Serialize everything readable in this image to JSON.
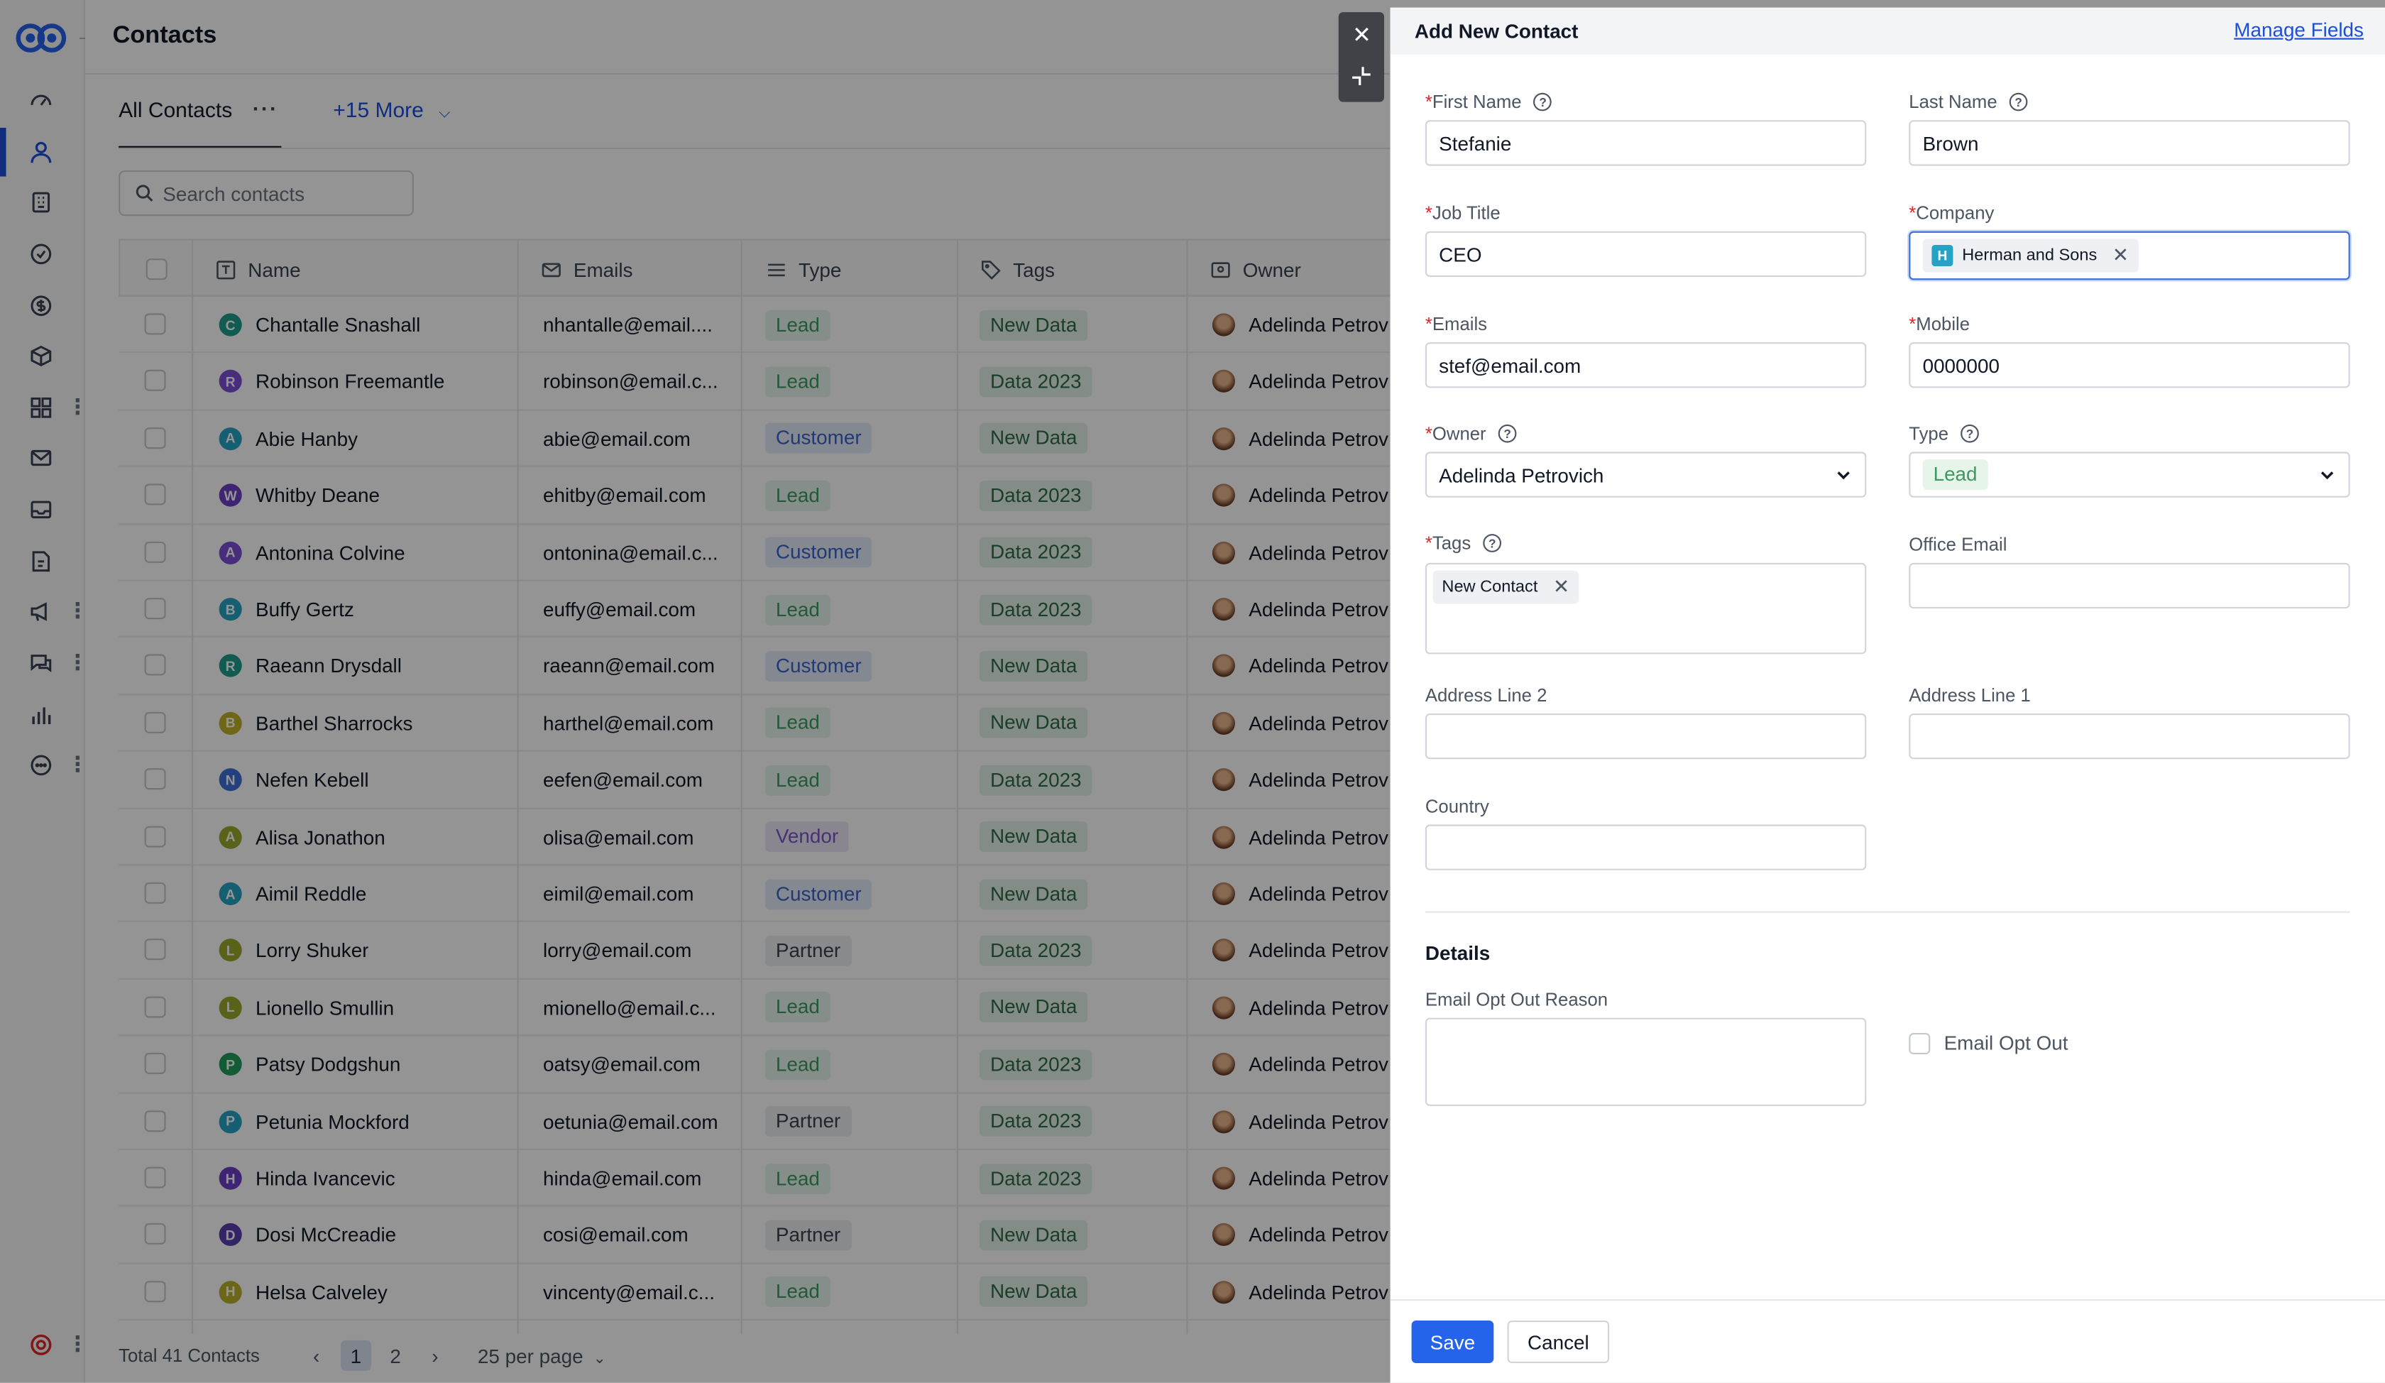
{
  "app": {
    "page_title": "Contacts"
  },
  "views": {
    "active": "All Contacts",
    "more": "+15 More"
  },
  "search": {
    "placeholder": "Search contacts"
  },
  "table": {
    "columns": [
      "Name",
      "Emails",
      "Type",
      "Tags",
      "Owner"
    ],
    "rows": [
      {
        "initial": "C",
        "name": "Chantalle Snashall",
        "email": "nhantalle@email....",
        "type": "Lead",
        "tag": "New Data",
        "owner": "Adelinda Petrov"
      },
      {
        "initial": "R",
        "name": "Robinson Freemantle",
        "email": "robinson@email.c...",
        "type": "Lead",
        "tag": "Data 2023",
        "owner": "Adelinda Petrov"
      },
      {
        "initial": "A",
        "name": "Abie Hanby",
        "email": "abie@email.com",
        "type": "Customer",
        "tag": "New Data",
        "owner": "Adelinda Petrov"
      },
      {
        "initial": "W",
        "name": "Whitby Deane",
        "email": "ehitby@email.com",
        "type": "Lead",
        "tag": "Data 2023",
        "owner": "Adelinda Petrov"
      },
      {
        "initial": "A",
        "name": "Antonina Colvine",
        "email": "ontonina@email.c...",
        "type": "Customer",
        "tag": "Data 2023",
        "owner": "Adelinda Petrov"
      },
      {
        "initial": "B",
        "name": "Buffy Gertz",
        "email": "euffy@email.com",
        "type": "Lead",
        "tag": "Data 2023",
        "owner": "Adelinda Petrov"
      },
      {
        "initial": "R",
        "name": "Raeann Drysdall",
        "email": "raeann@email.com",
        "type": "Customer",
        "tag": "New Data",
        "owner": "Adelinda Petrov"
      },
      {
        "initial": "B",
        "name": "Barthel Sharrocks",
        "email": "harthel@email.com",
        "type": "Lead",
        "tag": "New Data",
        "owner": "Adelinda Petrov"
      },
      {
        "initial": "N",
        "name": "Nefen Kebell",
        "email": "eefen@email.com",
        "type": "Lead",
        "tag": "Data 2023",
        "owner": "Adelinda Petrov"
      },
      {
        "initial": "A",
        "name": "Alisa Jonathon",
        "email": "olisa@email.com",
        "type": "Vendor",
        "tag": "New Data",
        "owner": "Adelinda Petrov"
      },
      {
        "initial": "A",
        "name": "Aimil Reddle",
        "email": "eimil@email.com",
        "type": "Customer",
        "tag": "New Data",
        "owner": "Adelinda Petrov"
      },
      {
        "initial": "L",
        "name": "Lorry Shuker",
        "email": "lorry@email.com",
        "type": "Partner",
        "tag": "Data 2023",
        "owner": "Adelinda Petrov"
      },
      {
        "initial": "L",
        "name": "Lionello Smullin",
        "email": "mionello@email.c...",
        "type": "Lead",
        "tag": "New Data",
        "owner": "Adelinda Petrov"
      },
      {
        "initial": "P",
        "name": "Patsy Dodgshun",
        "email": "oatsy@email.com",
        "type": "Lead",
        "tag": "Data 2023",
        "owner": "Adelinda Petrov"
      },
      {
        "initial": "P",
        "name": "Petunia Mockford",
        "email": "oetunia@email.com",
        "type": "Partner",
        "tag": "Data 2023",
        "owner": "Adelinda Petrov"
      },
      {
        "initial": "H",
        "name": "Hinda Ivancevic",
        "email": "hinda@email.com",
        "type": "Lead",
        "tag": "Data 2023",
        "owner": "Adelinda Petrov"
      },
      {
        "initial": "D",
        "name": "Dosi McCreadie",
        "email": "cosi@email.com",
        "type": "Partner",
        "tag": "New Data",
        "owner": "Adelinda Petrov"
      },
      {
        "initial": "H",
        "name": "Helsa Calveley",
        "email": "vincenty@email.c...",
        "type": "Lead",
        "tag": "New Data",
        "owner": "Adelinda Petrov"
      }
    ]
  },
  "footer": {
    "total": "Total 41 Contacts",
    "pages": [
      "1",
      "2"
    ],
    "per_page": "25 per page"
  },
  "panel": {
    "title": "Add New Contact",
    "manage_fields": "Manage Fields",
    "fields": {
      "first_name": {
        "label": "First Name",
        "value": "Stefanie"
      },
      "last_name": {
        "label": "Last Name",
        "value": "Brown"
      },
      "job_title": {
        "label": "Job Title",
        "value": "CEO"
      },
      "company": {
        "label": "Company",
        "chip_initial": "H",
        "chip": "Herman and Sons"
      },
      "emails": {
        "label": "Emails",
        "value": "stef@email.com"
      },
      "mobile": {
        "label": "Mobile",
        "value": "0000000"
      },
      "owner": {
        "label": "Owner",
        "value": "Adelinda Petrovich"
      },
      "type": {
        "label": "Type",
        "value": "Lead"
      },
      "tags": {
        "label": "Tags",
        "chip": "New Contact"
      },
      "office_email": {
        "label": "Office Email",
        "value": ""
      },
      "address_line_2": {
        "label": "Address Line 2",
        "value": ""
      },
      "address_line_1": {
        "label": "Address Line 1",
        "value": ""
      },
      "country": {
        "label": "Country",
        "value": ""
      }
    },
    "details": {
      "title": "Details",
      "opt_out_reason_label": "Email Opt Out Reason",
      "opt_out_label": "Email Opt Out"
    },
    "save": "Save",
    "cancel": "Cancel"
  },
  "colors": {
    "primary": "#2563eb",
    "lead_bg": "#e6f4ea",
    "lead_fg": "#3c9a5f",
    "customer_bg": "#e3ebfa",
    "customer_fg": "#3b63c4",
    "vendor_bg": "#ede7f8",
    "vendor_fg": "#7c55c7",
    "partner_bg": "#eceef1",
    "partner_fg": "#374151",
    "tag_bg": "#e3f2e8",
    "tag_fg": "#2d6b44"
  }
}
